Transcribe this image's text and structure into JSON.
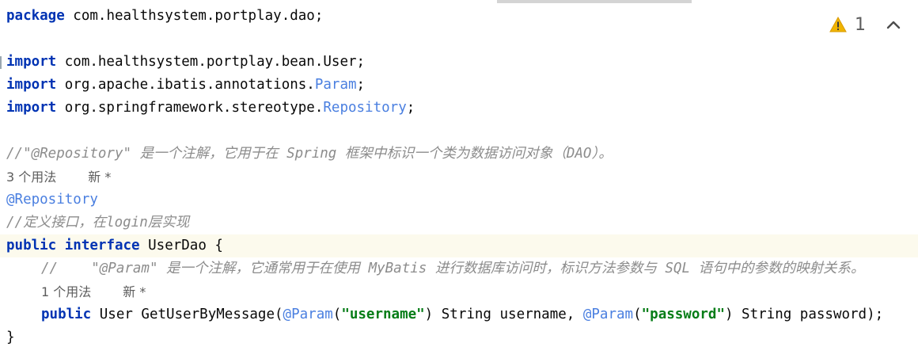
{
  "editor": {
    "lines": {
      "package_kw": "package",
      "package_name": " com.healthsystem.portplay.dao;",
      "import1_kw": "import",
      "import1_path": " com.healthsystem.portplay.bean.User;",
      "import2_kw": "import",
      "import2_path": " org.apache.ibatis.annotations.",
      "import2_class": "Param",
      "import2_end": ";",
      "import3_kw": "import",
      "import3_path": " org.springframework.stereotype.",
      "import3_class": "Repository",
      "import3_end": ";",
      "comment1": "//\"@Repository\" 是一个注解，它用于在 Spring 框架中标识一个类为数据访问对象（DAO）。",
      "hint1_usages": "3 个用法",
      "hint1_new": "新 *",
      "annotation": "@Repository",
      "comment2": "//定义接口，在login层实现",
      "iface_kw1": "public",
      "iface_kw2": "interface",
      "iface_name": " UserDao {",
      "comment3": "//    \"@Param\" 是一个注解，它通常用于在使用 MyBatis 进行数据库访问时，标识方法参数与 SQL 语句中的参数的映射关系。",
      "hint2_usages": "1 个用法",
      "hint2_new": "新 *",
      "method_kw": "public",
      "method_sig": " User GetUserByMessage(",
      "param1_ann": "@Param",
      "param1_open": "(",
      "param1_str": "\"username\"",
      "param1_rest": ") String username, ",
      "param2_ann": "@Param",
      "param2_open": "(",
      "param2_str": "\"password\"",
      "param2_rest": ") String password);",
      "close_brace": "}"
    }
  },
  "inspection": {
    "icon": "warning-icon",
    "warning_count": "1",
    "nav_icon": "chevron-up-icon"
  },
  "colors": {
    "keyword": "#0033b3",
    "annotation": "#4a7fe0",
    "string": "#067d17",
    "comment": "#8c8c8c",
    "current_line": "#fcfaed",
    "warning": "#f0b400"
  }
}
